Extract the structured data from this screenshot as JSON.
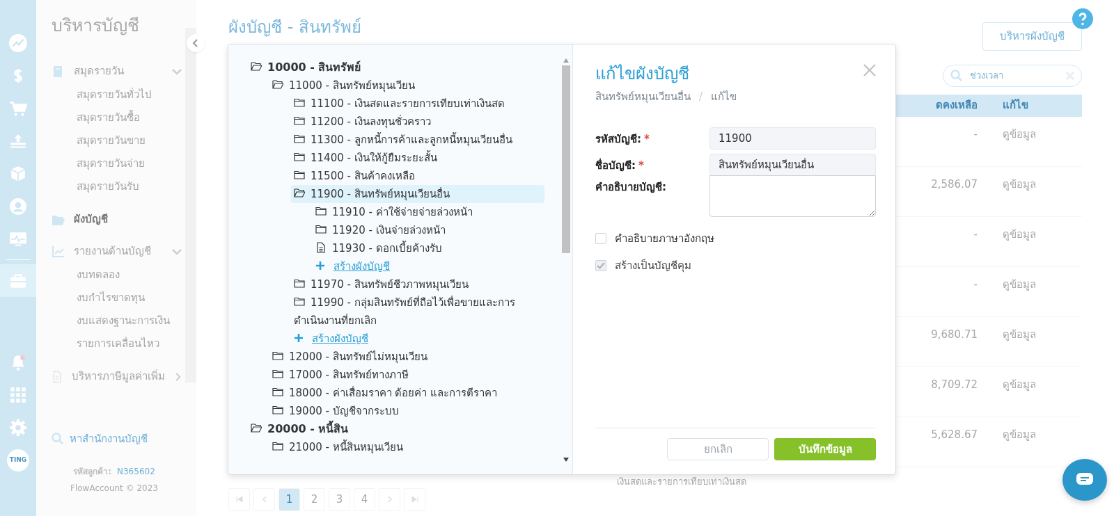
{
  "rail": [
    {
      "selected": false
    },
    {
      "selected": false
    },
    {
      "selected": false
    },
    {
      "selected": false
    },
    {
      "selected": false
    },
    {
      "selected": false
    },
    {
      "selected": false
    },
    {
      "selected": true
    },
    {
      "selected": false
    },
    {
      "selected": false
    },
    {
      "selected": false
    }
  ],
  "rail_avatar": "TING",
  "sidebar": {
    "title": "บริหารบัญชี",
    "groups": [
      {
        "label": "สมุดรายวัน",
        "expanded": true,
        "selected": false,
        "children": [
          "สมุดรายวันทั่วไป",
          "สมุดรายวันซื้อ",
          "สมุดรายวันขาย",
          "สมุดรายวันจ่าย",
          "สมุดรายวันรับ"
        ]
      },
      {
        "label": "ผังบัญชี",
        "selected": true
      },
      {
        "label": "รายงานด้านบัญชี",
        "expanded": true,
        "selected": false,
        "children": [
          "งบทดลอง",
          "งบกำไรขาดทุน",
          "งบแสดงฐานะการเงิน",
          "รายการเคลื่อนไหว"
        ]
      },
      {
        "label": "บริหารภาษีมูลค่าเพิ่ม",
        "expanded": false,
        "selected": false
      }
    ],
    "find_office": "หาสำนักงานบัญชี",
    "customer_label": "รหัสลูกค้า:",
    "customer_id": "N365602",
    "copyright": "FlowAccount © 2023"
  },
  "page_title": "ผังบัญชี - สินทรัพย์",
  "manage_button": "บริหารผังบัญชี",
  "search": {
    "placeholder": "ช่วงเวลา"
  },
  "table": {
    "columns": [
      "ดคงเหลือ",
      "แก้ไข"
    ],
    "rows": [
      {
        "balance": "-",
        "action": "ดูข้อมูล"
      },
      {
        "balance": "2,586.07",
        "action": "ดูข้อมูล"
      },
      {
        "balance": "-",
        "action": "ดูข้อมูล"
      },
      {
        "balance": "-",
        "action": "ดูข้อมูล"
      },
      {
        "balance": "9,680.71",
        "action": "ดูข้อมูล"
      },
      {
        "balance": "8,709.72",
        "action": "ดูข้อมูล"
      },
      {
        "balance": "5,628.67",
        "action": "ดูข้อมูล",
        "description": "เงินสดและรายการเทียบเท่าเงินสด"
      }
    ]
  },
  "pagination": [
    {
      "label": "1",
      "selected": true
    },
    {
      "label": "2",
      "selected": false
    },
    {
      "label": "3",
      "selected": false
    },
    {
      "label": "4",
      "selected": false
    }
  ],
  "tree": [
    {
      "kind": "folder",
      "open": true,
      "selected": false,
      "text": "10000 - สินทรัพย์",
      "children": [
        {
          "kind": "folder",
          "open": true,
          "selected": false,
          "text": "11000 - สินทรัพย์หมุนเวียน",
          "children": [
            {
              "kind": "folder",
              "open": false,
              "selected": false,
              "text": "11100 - เงินสดและรายการเทียบเท่าเงินสด"
            },
            {
              "kind": "folder",
              "open": false,
              "selected": false,
              "text": "11200 - เงินลงทุนชั่วคราว"
            },
            {
              "kind": "folder",
              "open": false,
              "selected": false,
              "text": "11300 - ลูกหนี้การค้าและลูกหนี้หมุนเวียนอื่น"
            },
            {
              "kind": "folder",
              "open": false,
              "selected": false,
              "text": "11400 - เงินให้กู้ยืมระยะสั้น"
            },
            {
              "kind": "folder",
              "open": false,
              "selected": false,
              "text": "11500 - สินค้าคงเหลือ"
            },
            {
              "kind": "folder",
              "open": true,
              "selected": true,
              "text": "11900 - สินทรัพย์หมุนเวียนอื่น",
              "children": [
                {
                  "kind": "folder",
                  "open": false,
                  "selected": false,
                  "text": "11910 - ค่าใช้จ่ายจ่ายล่วงหน้า"
                },
                {
                  "kind": "folder",
                  "open": false,
                  "selected": false,
                  "text": "11920 - เงินจ่ายล่วงหน้า"
                },
                {
                  "kind": "file",
                  "selected": false,
                  "text": "11930 - ดอกเบี้ยค้างรับ"
                },
                {
                  "kind": "add",
                  "text": "สร้างผังบัญชี"
                }
              ]
            },
            {
              "kind": "folder",
              "open": false,
              "selected": false,
              "text": "11970 - สินทรัพย์ชีวภาพหมุนเวียน"
            },
            {
              "kind": "folder",
              "open": false,
              "selected": false,
              "text": "11990 - กลุ่มสินทรัพย์ที่ถือไว้เพื่อขายและการดำเนินงานที่ยกเลิก"
            },
            {
              "kind": "add",
              "text": "สร้างผังบัญชี"
            }
          ]
        },
        {
          "kind": "folder",
          "open": false,
          "selected": false,
          "text": "12000 - สินทรัพย์ไม่หมุนเวียน"
        },
        {
          "kind": "folder",
          "open": false,
          "selected": false,
          "text": "17000 - สินทรัพย์ทางภาษี"
        },
        {
          "kind": "folder",
          "open": false,
          "selected": false,
          "text": "18000 - ค่าเสื่อมราคา ด้อยค่า และการตีราคา"
        },
        {
          "kind": "folder",
          "open": false,
          "selected": false,
          "text": "19000 - บัญชีจากระบบ"
        }
      ]
    },
    {
      "kind": "folder",
      "open": true,
      "selected": false,
      "text": "20000 - หนี้สิน",
      "children": [
        {
          "kind": "folder",
          "open": false,
          "selected": false,
          "text": "21000 - หนี้สินหมุนเวียน"
        }
      ]
    }
  ],
  "form": {
    "title": "แก้ไขผังบัญชี",
    "breadcrumb": [
      "สินทรัพย์หมุนเวียนอื่น",
      "แก้ไข"
    ],
    "separator": "/",
    "fields": [
      {
        "kind": "input",
        "label": "รหัสบัญชี:",
        "required_mark": "*",
        "value": "11900"
      },
      {
        "kind": "input",
        "label": "ชื่อบัญชี:",
        "required_mark": "*",
        "value": "สินทรัพย์หมุนเวียนอื่น"
      },
      {
        "kind": "textarea",
        "label": "คำอธิบายบัญชี:"
      }
    ],
    "checkboxes": [
      {
        "label": "คำอธิบายภาษาอังกฤษ",
        "checked": false,
        "disabled": false
      },
      {
        "label": "สร้างเป็นบัญชีคุม",
        "checked": true,
        "disabled": true
      }
    ],
    "cancel": "ยกเลิก",
    "save": "บันทึกข้อมูล"
  }
}
